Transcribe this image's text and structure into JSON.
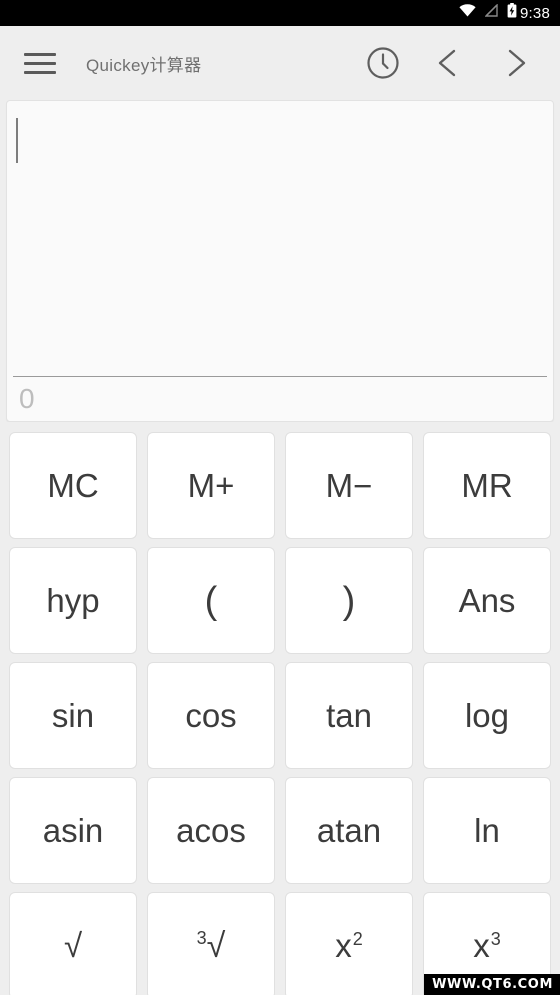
{
  "statusbar": {
    "time": "9:38",
    "icons": [
      "wifi-icon",
      "signal-off-icon",
      "battery-charging-icon"
    ]
  },
  "appbar": {
    "menu_icon": "hamburger-menu-icon",
    "title": "Quickey计算器",
    "actions": [
      {
        "name": "history-clock-icon",
        "label": "history"
      },
      {
        "name": "chevron-left-icon",
        "label": "previous"
      },
      {
        "name": "chevron-right-icon",
        "label": "next"
      }
    ]
  },
  "display": {
    "expression": "",
    "result": "0"
  },
  "keypad": {
    "rows": [
      [
        {
          "label": "MC",
          "name": "key-mc"
        },
        {
          "label": "M+",
          "name": "key-m-plus"
        },
        {
          "label": "M−",
          "name": "key-m-minus"
        },
        {
          "label": "MR",
          "name": "key-mr"
        }
      ],
      [
        {
          "label": "hyp",
          "name": "key-hyp"
        },
        {
          "label": "(",
          "name": "key-open-paren"
        },
        {
          "label": ")",
          "name": "key-close-paren"
        },
        {
          "label": "Ans",
          "name": "key-ans"
        }
      ],
      [
        {
          "label": "sin",
          "name": "key-sin"
        },
        {
          "label": "cos",
          "name": "key-cos"
        },
        {
          "label": "tan",
          "name": "key-tan"
        },
        {
          "label": "log",
          "name": "key-log"
        }
      ],
      [
        {
          "label": "asin",
          "name": "key-asin"
        },
        {
          "label": "acos",
          "name": "key-acos"
        },
        {
          "label": "atan",
          "name": "key-atan"
        },
        {
          "label": "ln",
          "name": "key-ln"
        }
      ],
      [
        {
          "label": "√",
          "name": "key-sqrt"
        },
        {
          "label": "³√",
          "name": "key-cbrt",
          "pre_sup": "3",
          "base": "√"
        },
        {
          "label": "x²",
          "name": "key-x-squared",
          "base": "x",
          "sup": "2"
        },
        {
          "label": "x³",
          "name": "key-x-cubed",
          "base": "x",
          "sup": "3"
        }
      ]
    ]
  },
  "watermark": {
    "text": "WWW.QT6.COM"
  },
  "colors": {
    "background": "#eeeeee",
    "key_face": "#ffffff",
    "key_border": "#e0e0e0",
    "key_text": "#3c3c3c",
    "title_text": "#707070",
    "result_text": "#bdbdbd",
    "statusbar_bg": "#000000"
  }
}
